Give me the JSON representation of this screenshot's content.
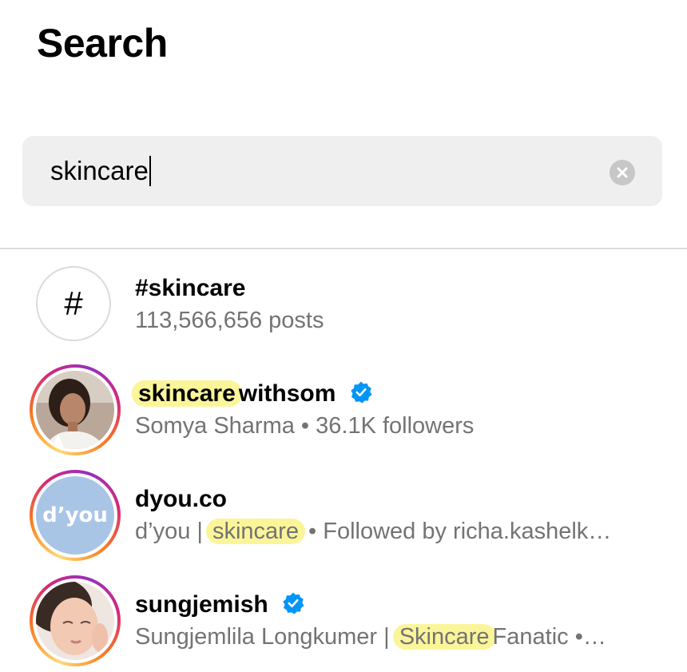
{
  "header": {
    "title": "Search"
  },
  "search": {
    "query": "skincare"
  },
  "results": [
    {
      "title": "#skincare",
      "subtitle": "113,566,656 posts",
      "icon": "hashtag-icon"
    },
    {
      "username_highlight": "skincare",
      "username_rest": "withsom",
      "verified": true,
      "subtitle": "Somya Sharma • 36.1K followers"
    },
    {
      "username": "dyou.co",
      "avatar_text": "d’you",
      "subtitle_before": "d’you |",
      "subtitle_highlight": "skincare",
      "subtitle_after": "• Followed by richa.kashelk…"
    },
    {
      "username": "sungjemish",
      "verified": true,
      "subtitle_before": "Sungjemlila Longkumer |",
      "subtitle_highlight": "Skincare",
      "subtitle_after": "Fanatic •…"
    }
  ],
  "colors": {
    "accent_verified": "#0095f6",
    "highlight": "#fbf59a",
    "secondary_text": "#737373",
    "search_bg": "#efefef"
  }
}
